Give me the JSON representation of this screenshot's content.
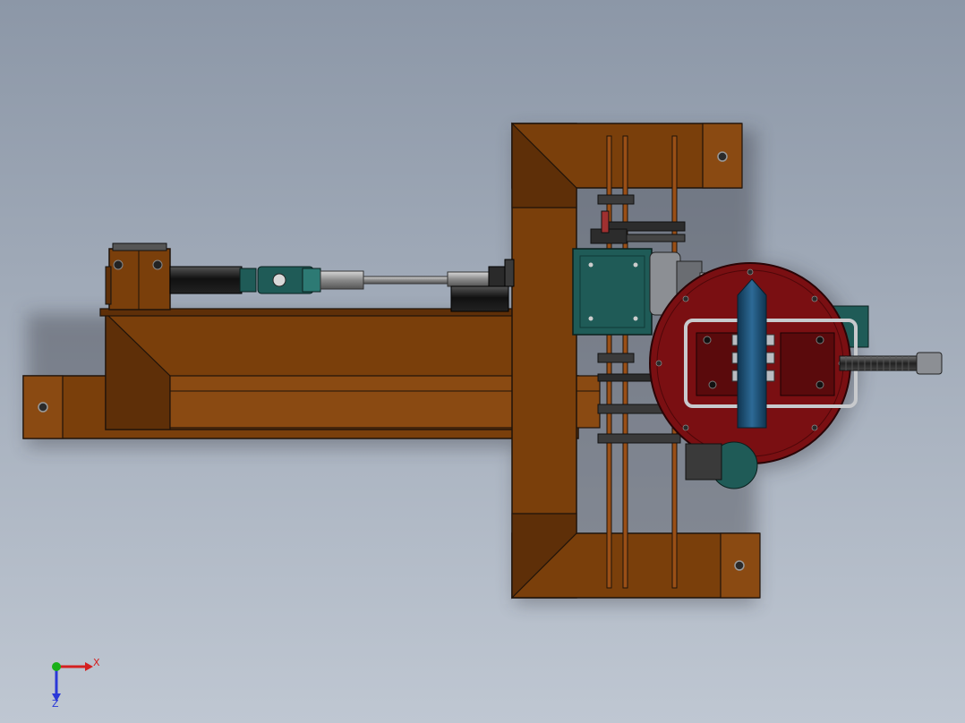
{
  "view": {
    "background_top": "#8c97a7",
    "background_bottom": "#bfc7d2"
  },
  "colors": {
    "frame": "#7a3f0b",
    "frame_dark": "#5e2f08",
    "frame_light": "#8a4a12",
    "outline": "#1f130a",
    "turntable": "#7a0f12",
    "motor_teal": "#1f5b57",
    "cylinder_dark": "#1a1a1a",
    "workpiece_blue": "#1c4f73",
    "silver": "#b9bcc1"
  },
  "triad": {
    "x_label": "X",
    "z_label": "Z",
    "x_color": "#d42020",
    "y_color": "#18b018",
    "z_color": "#2a38d8"
  }
}
